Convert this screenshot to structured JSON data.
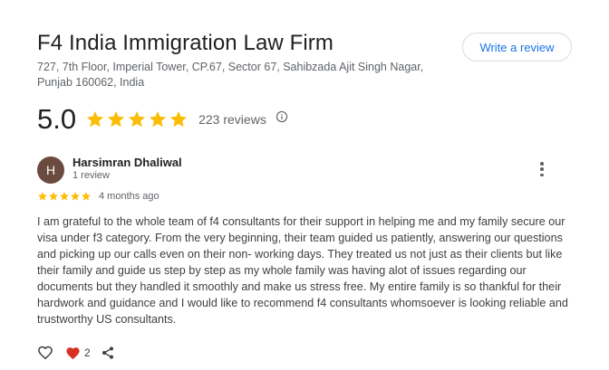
{
  "business": {
    "name": "F4 India Immigration Law Firm",
    "address": "727, 7th Floor, Imperial Tower, CP.67, Sector 67, Sahibzada Ajit Singh Nagar, Punjab 160062, India",
    "write_review_label": "Write a review",
    "rating": "5.0",
    "reviews_count": "223 reviews"
  },
  "review": {
    "avatar_letter": "H",
    "author": "Harsimran Dhaliwal",
    "author_meta": "1 review",
    "stars": 5,
    "time": "4 months ago",
    "text": "I am grateful to the whole team of f4 consultants for their support in helping me and my family secure our visa under f3 category. From the very beginning, their team guided us patiently, answering our questions and picking up our calls even on their non- working days. They treated us not just as their clients but like their family and guide us step by step as my whole family was having alot of issues regarding our documents but they handled it smoothly and make us stress free. My entire family is so thankful for their hardwork and guidance and I would like to recommend f4 consultants whomsoever is looking reliable and trustworthy US consultants.",
    "love_count": "2"
  },
  "colors": {
    "star": "#fbbc04",
    "accent": "#1a73e8",
    "heart": "#d93025",
    "avatar_bg": "#6b4a3f",
    "text_secondary": "#5f6368"
  },
  "icons": {
    "info": "info-icon",
    "more": "more-vert-icon",
    "like": "heart-outline-icon",
    "love": "heart-filled-icon",
    "share": "share-icon"
  }
}
